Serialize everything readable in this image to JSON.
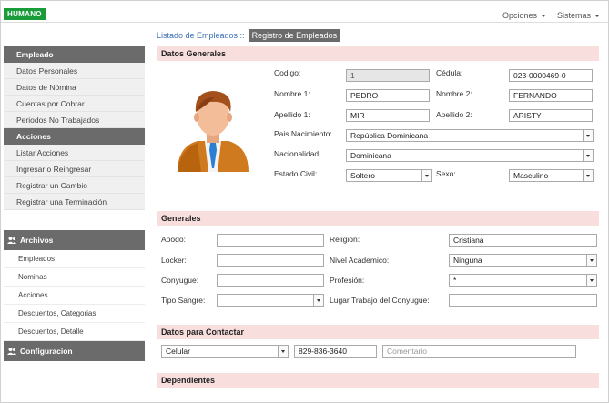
{
  "app": {
    "logo": "HUMANO"
  },
  "topnav": {
    "options_label": "Opciones",
    "systems_label": "Sistemas"
  },
  "breadcrumb": {
    "link": "Listado de Empleados ::",
    "active": "Registro de Empleados"
  },
  "sidebar": {
    "empleado_header": "Empleado",
    "empleado_items": [
      "Datos Personales",
      "Datos de Nómina",
      "Cuentas por Cobrar",
      "Periodos No Trabajados"
    ],
    "acciones_header": "Acciones",
    "acciones_items": [
      "Listar Acciones",
      "Ingresar o Reingresar",
      "Registrar un Cambio",
      "Registrar una Terminación"
    ],
    "archivos_label": "Archivos",
    "archivos_items": [
      "Empleados",
      "Nominas",
      "Acciones",
      "Descuentos, Categorias",
      "Descuentos, Detalle"
    ],
    "configuracion_label": "Configuracion"
  },
  "datos_generales": {
    "title": "Datos Generales",
    "codigo_label": "Codigo:",
    "codigo_value": "1",
    "cedula_label": "Cédula:",
    "cedula_value": "023-0000469-0",
    "nombre1_label": "Nombre 1:",
    "nombre1_value": "PEDRO",
    "nombre2_label": "Nombre 2:",
    "nombre2_value": "FERNANDO",
    "apellido1_label": "Apellido 1:",
    "apellido1_value": "MIR",
    "apellido2_label": "Apellido 2:",
    "apellido2_value": "ARISTY",
    "pais_label": "Pais Nacimiento:",
    "pais_value": "República Dominicana",
    "nacionalidad_label": "Nacionalidad:",
    "nacionalidad_value": "Dominicana",
    "estado_civil_label": "Estado Civil:",
    "estado_civil_value": "Soltero",
    "sexo_label": "Sexo:",
    "sexo_value": "Masculino"
  },
  "generales": {
    "title": "Generales",
    "apodo_label": "Apodo:",
    "apodo_value": "",
    "religion_label": "Religion:",
    "religion_value": "Cristiana",
    "locker_label": "Locker:",
    "locker_value": "",
    "nivel_label": "Nivel Academico:",
    "nivel_value": "Ninguna",
    "conyugue_label": "Conyugue:",
    "conyugue_value": "",
    "profesion_label": "Profesión:",
    "profesion_value": "*",
    "tipo_sangre_label": "Tipo Sangre:",
    "tipo_sangre_value": "",
    "lugar_trabajo_label": "Lugar Trabajo del Conyugue:",
    "lugar_trabajo_value": ""
  },
  "contacto": {
    "title": "Datos para Contactar",
    "tipo_value": "Celular",
    "numero_value": "829-836-3640",
    "comentario_placeholder": "Comentario"
  },
  "dependientes": {
    "title": "Dependientes"
  },
  "colors": {
    "logo_green": "#1a9c3b",
    "sidebar_dark": "#6b6b6b",
    "section_pink": "#f9dede",
    "link_blue": "#3a6fb0"
  }
}
